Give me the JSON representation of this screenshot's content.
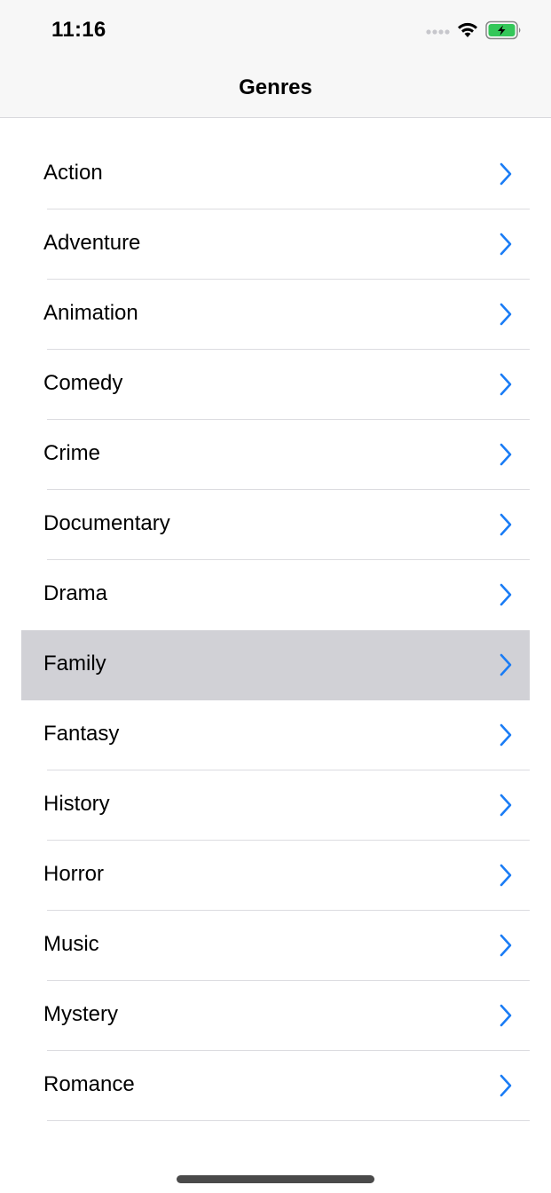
{
  "status_bar": {
    "time": "11:16"
  },
  "nav": {
    "title": "Genres"
  },
  "genres": [
    {
      "label": "Action"
    },
    {
      "label": "Adventure"
    },
    {
      "label": "Animation"
    },
    {
      "label": "Comedy"
    },
    {
      "label": "Crime"
    },
    {
      "label": "Documentary"
    },
    {
      "label": "Drama"
    },
    {
      "label": "Family",
      "selected": true
    },
    {
      "label": "Fantasy"
    },
    {
      "label": "History"
    },
    {
      "label": "Horror"
    },
    {
      "label": "Music"
    },
    {
      "label": "Mystery"
    },
    {
      "label": "Romance"
    }
  ],
  "colors": {
    "accent": "#1a7cf5",
    "selected_row": "#d1d1d6",
    "battery": "#34c759"
  }
}
